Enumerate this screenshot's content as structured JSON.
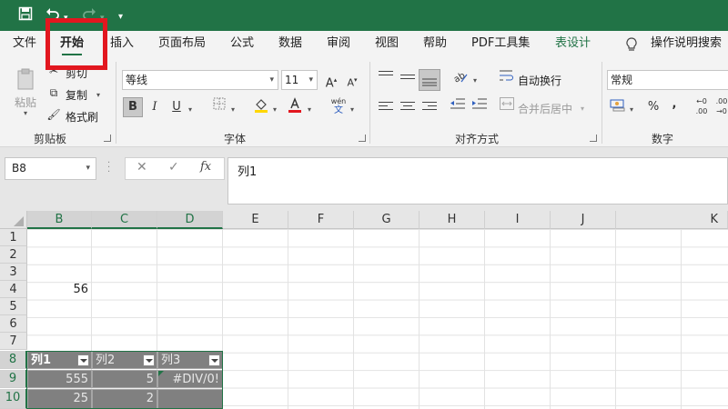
{
  "ribbon_tabs": {
    "file": "文件",
    "home": "开始",
    "insert": "插入",
    "layout": "页面布局",
    "formulas": "公式",
    "data": "数据",
    "review": "审阅",
    "view": "视图",
    "help": "帮助",
    "pdf": "PDF工具集",
    "table_design": "表设计",
    "tell_me": "操作说明搜索"
  },
  "clipboard": {
    "paste": "粘贴",
    "cut": "剪切",
    "copy": "复制",
    "format_painter": "格式刷",
    "group": "剪贴板"
  },
  "font": {
    "name": "等线",
    "size": "11",
    "group": "字体",
    "bold": "B",
    "italic": "I",
    "underline": "U",
    "grow": "A",
    "shrink": "A",
    "phonetic_top": "wén",
    "phonetic_bottom": "文"
  },
  "alignment": {
    "wrap": "自动换行",
    "merge": "合并后居中",
    "group": "对齐方式"
  },
  "number": {
    "format": "常规",
    "group": "数字",
    "percent": "%",
    "comma": ",",
    "inc_top": "←0",
    "inc_bottom": ".00",
    "dec_top": ".00",
    "dec_bottom": "→0"
  },
  "formula_bar": {
    "name_box": "B8",
    "fx": "fx",
    "content": "列1"
  },
  "columns": [
    "B",
    "C",
    "D",
    "E",
    "F",
    "G",
    "H",
    "I",
    "J",
    "K"
  ],
  "rows": [
    "1",
    "2",
    "3",
    "4",
    "5",
    "6",
    "7",
    "8",
    "9",
    "10"
  ],
  "cells": {
    "b4": "56"
  },
  "table": {
    "headers": [
      "列1",
      "列2",
      "列3"
    ],
    "rows": [
      [
        "555",
        "5",
        "#DIV/0!"
      ],
      [
        "25",
        "2",
        ""
      ]
    ]
  },
  "colors": {
    "accent": "#217346",
    "highlight": "#e2171f",
    "table_fill": "#808080"
  }
}
